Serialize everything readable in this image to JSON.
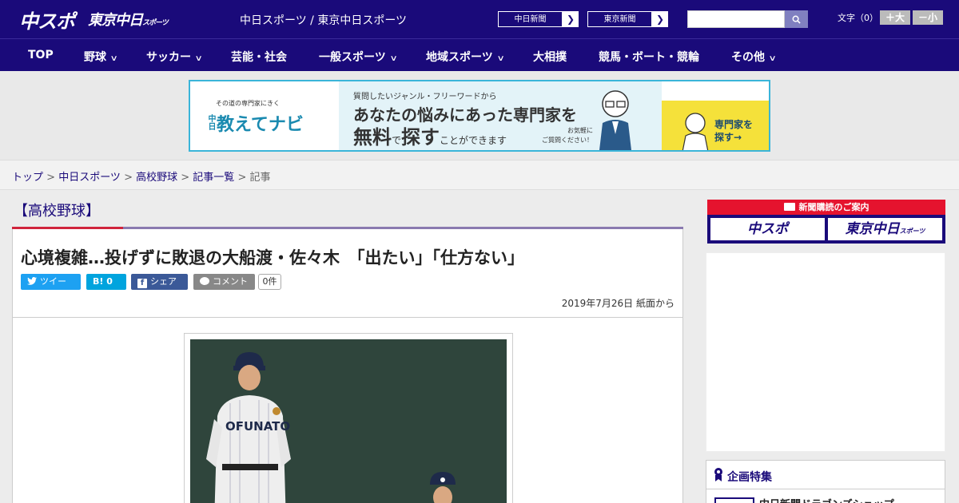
{
  "header": {
    "logo_primary": "中スポ",
    "logo_secondary": "東京中日",
    "logo_secondary_small": "スポーツ",
    "site_name": "中日スポーツ / 東京中日スポーツ",
    "paper_buttons": [
      "中日新聞",
      "東京新聞"
    ],
    "font_size_label": "文字（0）",
    "font_larger": "＋大",
    "font_smaller": "－小"
  },
  "nav": {
    "items": [
      {
        "label": "TOP",
        "has_menu": false
      },
      {
        "label": "野球",
        "has_menu": true
      },
      {
        "label": "サッカー",
        "has_menu": true
      },
      {
        "label": "芸能・社会",
        "has_menu": false
      },
      {
        "label": "一般スポーツ",
        "has_menu": true
      },
      {
        "label": "地域スポーツ",
        "has_menu": true
      },
      {
        "label": "大相撲",
        "has_menu": false
      },
      {
        "label": "競馬・ボート・競輪",
        "has_menu": false
      },
      {
        "label": "その他",
        "has_menu": true
      }
    ]
  },
  "banner": {
    "subtitle": "その道の専門家にきく",
    "brand_small": "中日",
    "brand": "教えてナビ",
    "question": "質問したいジャンル・フリーワードから",
    "headline1": "あなたの悩みにあった専門家を",
    "headline2_a": "無料",
    "headline2_b": "で",
    "headline2_c": "探す",
    "headline2_d": "ことができます",
    "note1": "お気軽に",
    "note2": "ご質問ください！",
    "cta1": "専門家を",
    "cta2": "探す→"
  },
  "breadcrumb": {
    "items": [
      "トップ",
      "中日スポーツ",
      "高校野球",
      "記事一覧"
    ],
    "current": "記事",
    "sep": " > "
  },
  "article": {
    "category": "【高校野球】",
    "headline": "心境複雑…投げずに敗退の大船渡・佐々木　「出たい」「仕方ない」",
    "social": {
      "tweet": "ツイート",
      "hatena": "B! 0",
      "share": "シェア 0",
      "comment": "コメント",
      "comment_count": "0件"
    },
    "date": "2019年7月26日 紙面から",
    "photo_jersey_text": "OFUNATO"
  },
  "sidebar": {
    "subscription_title": "新聞購読のご案内",
    "subscription_left": "中スポ",
    "subscription_right": "東京中日",
    "subscription_right_small": "スポーツ",
    "feature_title": "企画特集",
    "feature_item": "中日新聞ドラゴンズショップ"
  },
  "colors": {
    "brand": "#1a0a7a",
    "accent_red": "#d0243c",
    "banner_border": "#3ab5d9",
    "banner_yellow": "#f5e13a"
  }
}
